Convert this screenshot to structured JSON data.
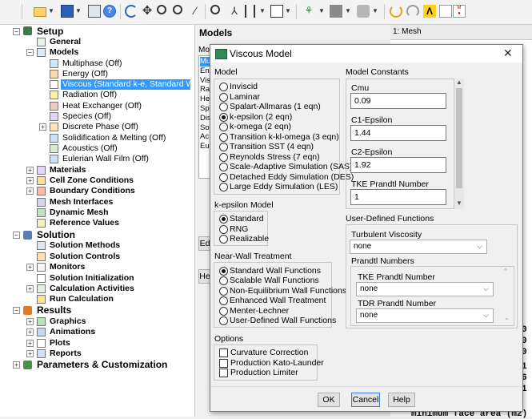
{
  "toolbar": {
    "icons": [
      "open-file-icon",
      "save-icon",
      "display-icon",
      "help-icon",
      "rotate-icon",
      "pan-icon",
      "zoom-in-icon",
      "zoom-box-icon",
      "probe-icon",
      "fit-icon",
      "axes-icon",
      "views-icon",
      "frame-icon",
      "color-icon",
      "lighting-icon",
      "model-icon",
      "refresh-icon",
      "fluent-logo-icon",
      "mesh-display-icon"
    ]
  },
  "tree": {
    "items": [
      {
        "label": "Setup"
      },
      {
        "label": "General"
      },
      {
        "label": "Models"
      },
      {
        "label": "Multiphase (Off)"
      },
      {
        "label": "Energy (Off)"
      },
      {
        "label": "Viscous (Standard k-e, Standard Wall F"
      },
      {
        "label": "Radiation (Off)"
      },
      {
        "label": "Heat Exchanger (Off)"
      },
      {
        "label": "Species (Off)"
      },
      {
        "label": "Discrete Phase (Off)"
      },
      {
        "label": "Solidification & Melting (Off)"
      },
      {
        "label": "Acoustics (Off)"
      },
      {
        "label": "Eulerian Wall Film (Off)"
      },
      {
        "label": "Materials"
      },
      {
        "label": "Cell Zone Conditions"
      },
      {
        "label": "Boundary Conditions"
      },
      {
        "label": "Mesh Interfaces"
      },
      {
        "label": "Dynamic Mesh"
      },
      {
        "label": "Reference Values"
      },
      {
        "label": "Solution"
      },
      {
        "label": "Solution Methods"
      },
      {
        "label": "Solution Controls"
      },
      {
        "label": "Monitors"
      },
      {
        "label": "Solution Initialization"
      },
      {
        "label": "Calculation Activities"
      },
      {
        "label": "Run Calculation"
      },
      {
        "label": "Results"
      },
      {
        "label": "Graphics"
      },
      {
        "label": "Animations"
      },
      {
        "label": "Plots"
      },
      {
        "label": "Reports"
      },
      {
        "label": "Parameters & Customization"
      }
    ],
    "selected": "Viscous (Standard k-e, Standard Wall F"
  },
  "models_panel": {
    "title": "Models",
    "list_header": "Mod",
    "list_items": [
      "Mu",
      "En",
      "Vis",
      "Ra",
      "He",
      "Sp",
      "Dis",
      "So",
      "Ac",
      "Eu"
    ],
    "edit_button": "Ed",
    "help_button": "He"
  },
  "mesh_window": {
    "dropdown": "1: Mesh",
    "console_fragments": [
      "0",
      "0",
      "0",
      "1",
      "6",
      "1"
    ],
    "console_bottom": "minimum face area (m2)"
  },
  "dialog": {
    "title": "Viscous Model",
    "model_group": "Model",
    "models": [
      {
        "label": "Inviscid",
        "selected": false
      },
      {
        "label": "Laminar",
        "selected": false
      },
      {
        "label": "Spalart-Allmaras (1 eqn)",
        "selected": false
      },
      {
        "label": "k-epsilon (2 eqn)",
        "selected": true
      },
      {
        "label": "k-omega (2 eqn)",
        "selected": false
      },
      {
        "label": "Transition k-kl-omega (3 eqn)",
        "selected": false
      },
      {
        "label": "Transition SST (4 eqn)",
        "selected": false
      },
      {
        "label": "Reynolds Stress (7 eqn)",
        "selected": false
      },
      {
        "label": "Scale-Adaptive Simulation (SAS)",
        "selected": false
      },
      {
        "label": "Detached Eddy Simulation (DES)",
        "selected": false
      },
      {
        "label": "Large Eddy Simulation (LES)",
        "selected": false
      }
    ],
    "ke_group": "k-epsilon Model",
    "ke_models": [
      {
        "label": "Standard",
        "selected": true
      },
      {
        "label": "RNG",
        "selected": false
      },
      {
        "label": "Realizable",
        "selected": false
      }
    ],
    "nw_group": "Near-Wall Treatment",
    "nw_options": [
      {
        "label": "Standard Wall Functions",
        "selected": true
      },
      {
        "label": "Scalable Wall Functions",
        "selected": false
      },
      {
        "label": "Non-Equilibrium Wall Functions",
        "selected": false
      },
      {
        "label": "Enhanced Wall Treatment",
        "selected": false
      },
      {
        "label": "Menter-Lechner",
        "selected": false
      },
      {
        "label": "User-Defined Wall Functions",
        "selected": false
      }
    ],
    "options_group": "Options",
    "options": [
      {
        "label": "Curvature Correction",
        "checked": false
      },
      {
        "label": "Production Kato-Launder",
        "checked": false
      },
      {
        "label": "Production Limiter",
        "checked": false
      }
    ],
    "constants_group": "Model Constants",
    "constants": [
      {
        "label": "Cmu",
        "value": "0.09"
      },
      {
        "label": "C1-Epsilon",
        "value": "1.44"
      },
      {
        "label": "C2-Epsilon",
        "value": "1.92"
      },
      {
        "label": "TKE Prandtl Number",
        "value": "1"
      }
    ],
    "udf_group": "User-Defined Functions",
    "turbulent_viscosity_label": "Turbulent Viscosity",
    "turbulent_viscosity_value": "none",
    "prandtl_group": "Prandtl Numbers",
    "tke_prandtl_label": "TKE Prandtl Number",
    "tke_prandtl_value": "none",
    "tdr_prandtl_label": "TDR Prandtl Number",
    "tdr_prandtl_value": "none",
    "ok": "OK",
    "cancel": "Cancel",
    "help": "Help"
  },
  "colors": {
    "selection": "#3399ff",
    "window_bg": "#f0f0f0",
    "title_accent": "#2e8b57"
  }
}
